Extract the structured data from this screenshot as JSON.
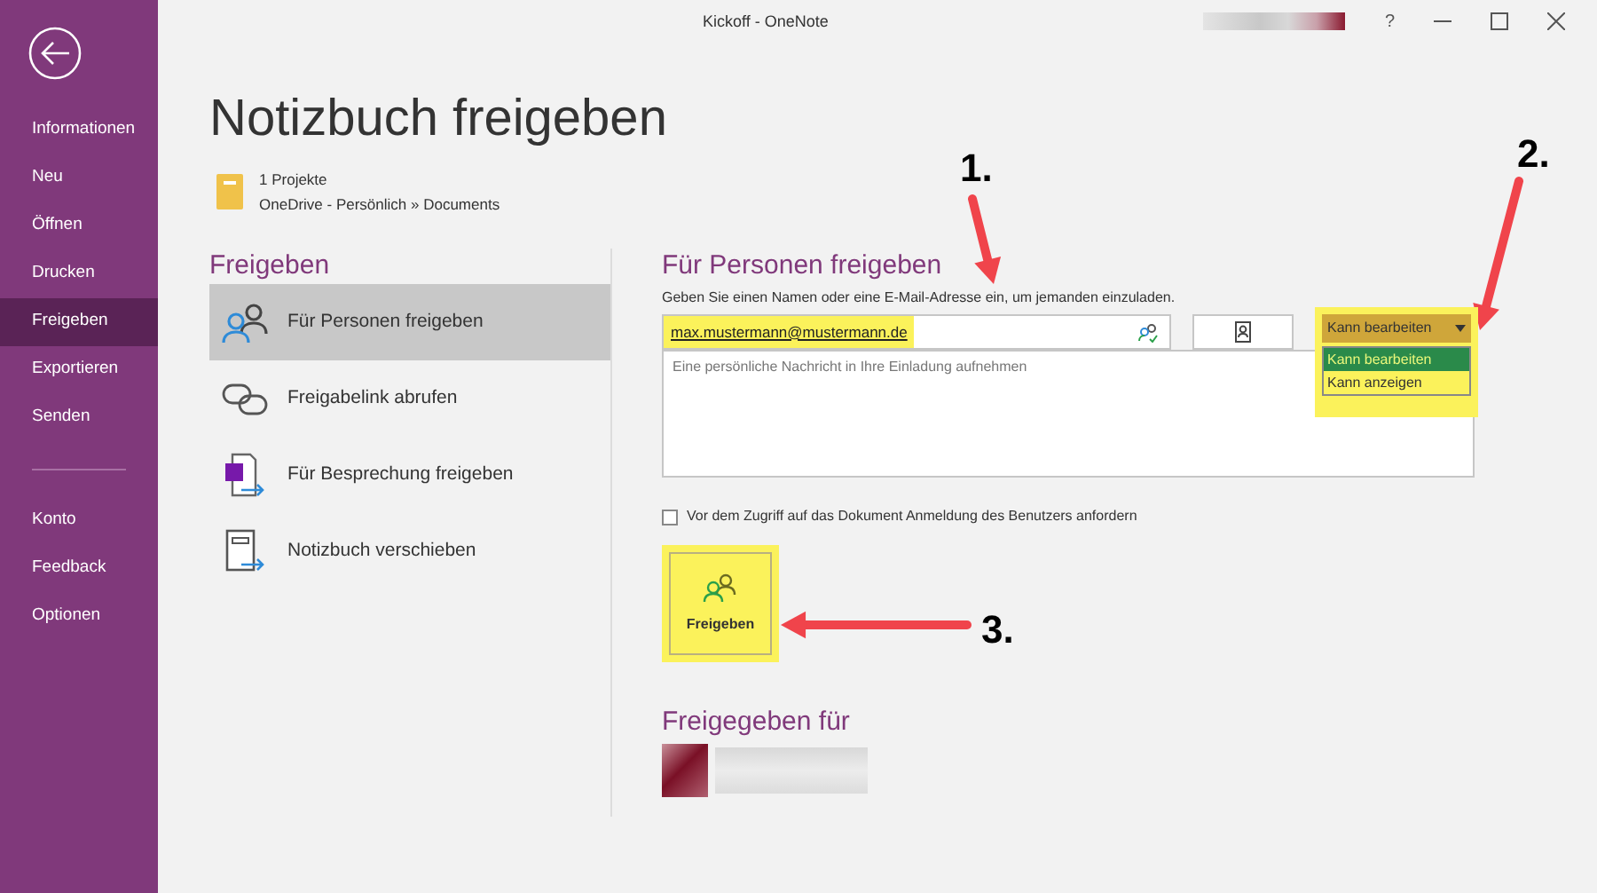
{
  "window": {
    "title": "Kickoff - OneNote",
    "help": "?"
  },
  "sidebar": {
    "items": [
      {
        "label": "Informationen",
        "selected": false
      },
      {
        "label": "Neu",
        "selected": false
      },
      {
        "label": "Öffnen",
        "selected": false
      },
      {
        "label": "Drucken",
        "selected": false
      },
      {
        "label": "Freigeben",
        "selected": true
      },
      {
        "label": "Exportieren",
        "selected": false
      },
      {
        "label": "Senden",
        "selected": false
      }
    ],
    "bottom_items": [
      {
        "label": "Konto",
        "selected": false
      },
      {
        "label": "Feedback",
        "selected": false
      },
      {
        "label": "Optionen",
        "selected": false
      }
    ]
  },
  "page": {
    "title": "Notizbuch freigeben",
    "notebook": {
      "name": "1 Projekte",
      "location": "OneDrive - Persönlich » Documents"
    }
  },
  "share_section": {
    "heading": "Freigeben",
    "options": [
      {
        "label": "Für Personen freigeben",
        "selected": true,
        "kind": "people"
      },
      {
        "label": "Freigabelink abrufen",
        "selected": false,
        "kind": "link"
      },
      {
        "label": "Für Besprechung freigeben",
        "selected": false,
        "kind": "meeting"
      },
      {
        "label": "Notizbuch verschieben",
        "selected": false,
        "kind": "move"
      }
    ]
  },
  "people_panel": {
    "heading": "Für Personen freigeben",
    "instruction": "Geben Sie einen Namen oder eine E-Mail-Adresse ein, um jemanden einzuladen.",
    "recipient": {
      "value": "max.mustermann@mustermann.de",
      "highlighted": true
    },
    "message": {
      "placeholder": "Eine persönliche Nachricht in Ihre Einladung aufnehmen"
    },
    "permission": {
      "value": "Kann bearbeiten",
      "expanded": true,
      "highlighted": true,
      "options": [
        {
          "label": "Kann bearbeiten",
          "selected": true
        },
        {
          "label": "Kann anzeigen",
          "selected": false
        }
      ]
    },
    "require_signin": {
      "label": "Vor dem Zugriff auf das Dokument Anmeldung des Benutzers anfordern",
      "checked": false
    },
    "share_button": {
      "label": "Freigeben",
      "highlighted": true
    },
    "shared_with": {
      "heading": "Freigegeben für"
    }
  },
  "annotations": [
    {
      "label": "1."
    },
    {
      "label": "2."
    },
    {
      "label": "3."
    }
  ]
}
